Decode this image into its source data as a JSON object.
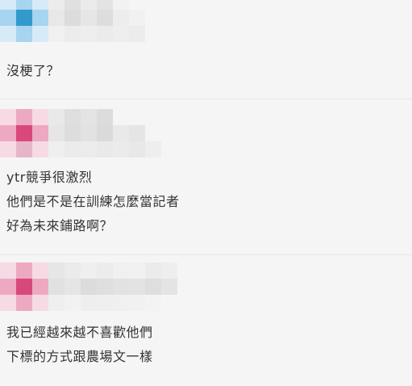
{
  "comments": [
    {
      "lines": [
        "沒梗了？"
      ],
      "colors": {
        "avatar_accent": "#3399cc"
      }
    },
    {
      "lines": [
        "ytr競爭很激烈",
        "他們是不是在訓練怎麼當記者",
        "好為未來鋪路啊？"
      ],
      "colors": {
        "avatar_accent": "#d9487a"
      }
    },
    {
      "lines": [
        "我已經越來越不喜歡他們",
        "下標的方式跟農場文一樣"
      ],
      "colors": {
        "avatar_accent": "#d9487a"
      }
    }
  ]
}
